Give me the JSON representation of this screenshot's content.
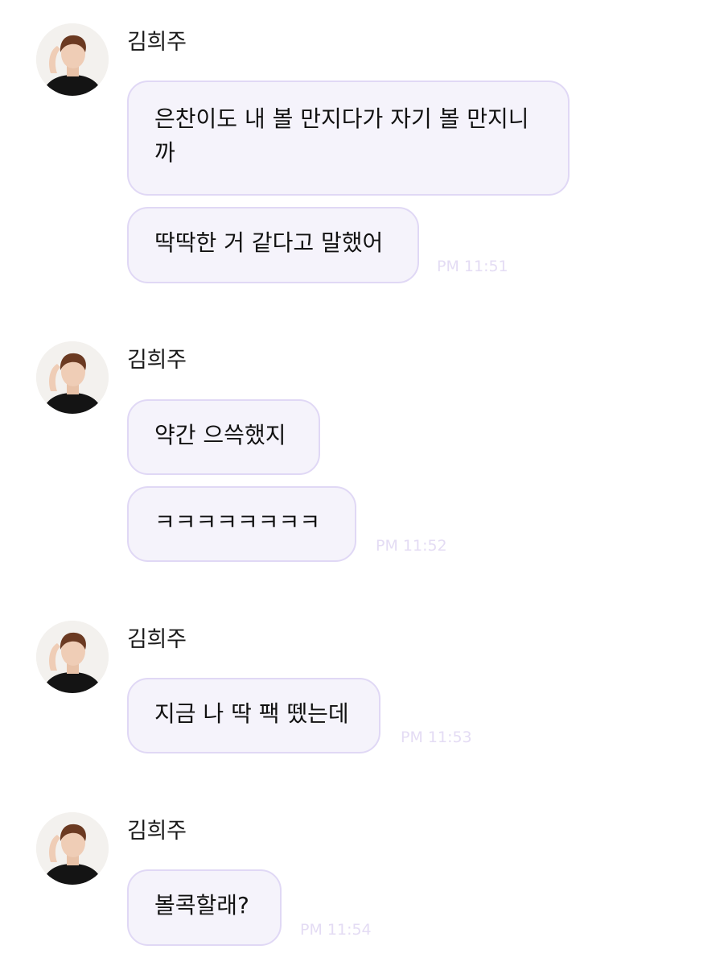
{
  "sender_name": "김희주",
  "groups": [
    {
      "messages": [
        "은찬이도 내 볼 만지다가 자기 볼 만지니\n까",
        "딱딱한 거 같다고 말했어"
      ],
      "time": "PM 11:51"
    },
    {
      "messages": [
        "약간 으쓱했지",
        "ㅋㅋㅋㅋㅋㅋㅋㅋ"
      ],
      "time": "PM 11:52"
    },
    {
      "messages": [
        "지금 나 딱 팩 뗐는데"
      ],
      "time": "PM 11:53"
    },
    {
      "messages": [
        "볼콕할래?"
      ],
      "time": "PM 11:54"
    }
  ],
  "colors": {
    "bubble_bg": "#f5f3fb",
    "bubble_border": "#e0d8f5",
    "timestamp": "#e4dcf4"
  },
  "icons": {
    "avatar": "profile-photo"
  }
}
